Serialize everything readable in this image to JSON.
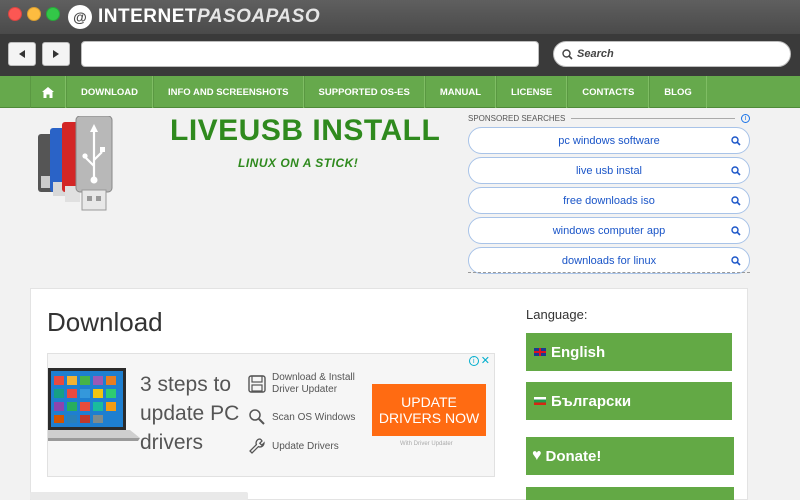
{
  "browser": {
    "brand_part1": "INTERNET",
    "brand_part2": "PASOAPASO",
    "brand_logo": "@",
    "back_icon": "left-arrow-icon",
    "forward_icon": "right-arrow-icon",
    "search_placeholder": "Search"
  },
  "menu": {
    "home_icon": "home-icon",
    "items": [
      "DOWNLOAD",
      "INFO AND SCREENSHOTS",
      "SUPPORTED OS-ES",
      "MANUAL",
      "LICENSE",
      "CONTACTS",
      "BLOG"
    ]
  },
  "header": {
    "title": "LIVEUSB INSTALL",
    "tagline": "LINUX ON A STICK!"
  },
  "sponsored": {
    "label": "SPONSORED SEARCHES",
    "info": "i",
    "items": [
      "pc windows software",
      "live usb instal",
      "free downloads iso",
      "windows computer app",
      "downloads for linux"
    ]
  },
  "content": {
    "heading": "Download",
    "language_label": "Language:",
    "languages": [
      "English",
      "Български"
    ],
    "donate": "Donate!"
  },
  "ad": {
    "headline": "3 steps to update PC drivers",
    "steps": [
      "Download & Install Driver Updater",
      "Scan OS Windows",
      "Update Drivers"
    ],
    "cta_line1": "UPDATE",
    "cta_line2": "DRIVERS NOW",
    "sub": "With Driver Updater",
    "close": "✕",
    "info": "i"
  },
  "colors": {
    "menu_green": "#66a94c",
    "title_green": "#2f8a1e",
    "button_green": "#63a945",
    "cta_orange": "#ff6b12",
    "link_blue": "#1a55c8"
  }
}
